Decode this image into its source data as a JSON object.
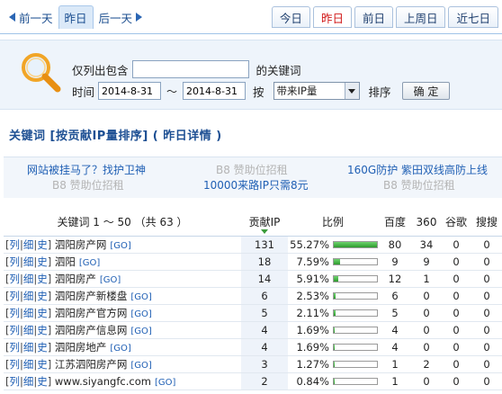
{
  "nav": {
    "prev_label": "前一天",
    "current_label": "昨日",
    "next_label": "后一天",
    "quick": [
      "今日",
      "昨日",
      "前日",
      "上周日",
      "近七日"
    ],
    "active_quick_index": 1
  },
  "search": {
    "only_label": "仅列出包含",
    "keyword_value": "",
    "keyword_suffix": "的关键词",
    "time_label": "时间",
    "date_from": "2014-8-31",
    "date_sep": "～",
    "date_to": "2014-8-31",
    "by_label": "按",
    "sort_field": "带来IP量",
    "sort_label": "排序",
    "confirm_label": "确 定"
  },
  "heading": "关键词 [按贡献IP量排序] ( 昨日详情 )",
  "ads": [
    {
      "text": "网站被挂马了？找护卫神",
      "type": "link"
    },
    {
      "text": "B8 赞助位招租",
      "type": "gray"
    },
    {
      "text": "160G防护 紫田双线高防上线",
      "type": "link"
    },
    {
      "text": "B8 赞助位招租",
      "type": "gray"
    },
    {
      "text": "10000来路IP只需8元",
      "type": "link"
    },
    {
      "text": "B8 赞助位招租",
      "type": "gray"
    }
  ],
  "table": {
    "headers": {
      "keyword": "关键词 1 ～ 50 （共 63 ）",
      "contrib": "贡献IP",
      "ratio": "比例",
      "baidu": "百度",
      "s360": "360",
      "google": "谷歌",
      "sogou": "搜搜"
    },
    "row_links": {
      "lie": "列",
      "xi": "细",
      "shi": "史",
      "go": "[GO]"
    },
    "rows": [
      {
        "keyword": "泗阳房产网",
        "ip": "131",
        "ratio": "55.27%",
        "ratio_value": 0.5527,
        "baidu": "80",
        "s360": "34",
        "google": "0",
        "sogou": "0"
      },
      {
        "keyword": "泗阳",
        "ip": "18",
        "ratio": "7.59%",
        "ratio_value": 0.0759,
        "baidu": "9",
        "s360": "9",
        "google": "0",
        "sogou": "0"
      },
      {
        "keyword": "泗阳房产",
        "ip": "14",
        "ratio": "5.91%",
        "ratio_value": 0.0591,
        "baidu": "12",
        "s360": "1",
        "google": "0",
        "sogou": "0"
      },
      {
        "keyword": "泗阳房产新楼盘",
        "ip": "6",
        "ratio": "2.53%",
        "ratio_value": 0.0253,
        "baidu": "6",
        "s360": "0",
        "google": "0",
        "sogou": "0"
      },
      {
        "keyword": "泗阳房产官方网",
        "ip": "5",
        "ratio": "2.11%",
        "ratio_value": 0.0211,
        "baidu": "5",
        "s360": "0",
        "google": "0",
        "sogou": "0"
      },
      {
        "keyword": "泗阳房产信息网",
        "ip": "4",
        "ratio": "1.69%",
        "ratio_value": 0.0169,
        "baidu": "4",
        "s360": "0",
        "google": "0",
        "sogou": "0"
      },
      {
        "keyword": "泗阳房地产",
        "ip": "4",
        "ratio": "1.69%",
        "ratio_value": 0.0169,
        "baidu": "4",
        "s360": "0",
        "google": "0",
        "sogou": "0"
      },
      {
        "keyword": "江苏泗阳房产网",
        "ip": "3",
        "ratio": "1.27%",
        "ratio_value": 0.0127,
        "baidu": "1",
        "s360": "2",
        "google": "0",
        "sogou": "0"
      },
      {
        "keyword": "www.siyangfc.com",
        "ip": "2",
        "ratio": "0.84%",
        "ratio_value": 0.0084,
        "baidu": "1",
        "s360": "0",
        "google": "0",
        "sogou": "0"
      }
    ]
  },
  "colors": {
    "accent": "#1d4f93",
    "active_tab": "#d01616",
    "bar": "#2c9a2c"
  }
}
